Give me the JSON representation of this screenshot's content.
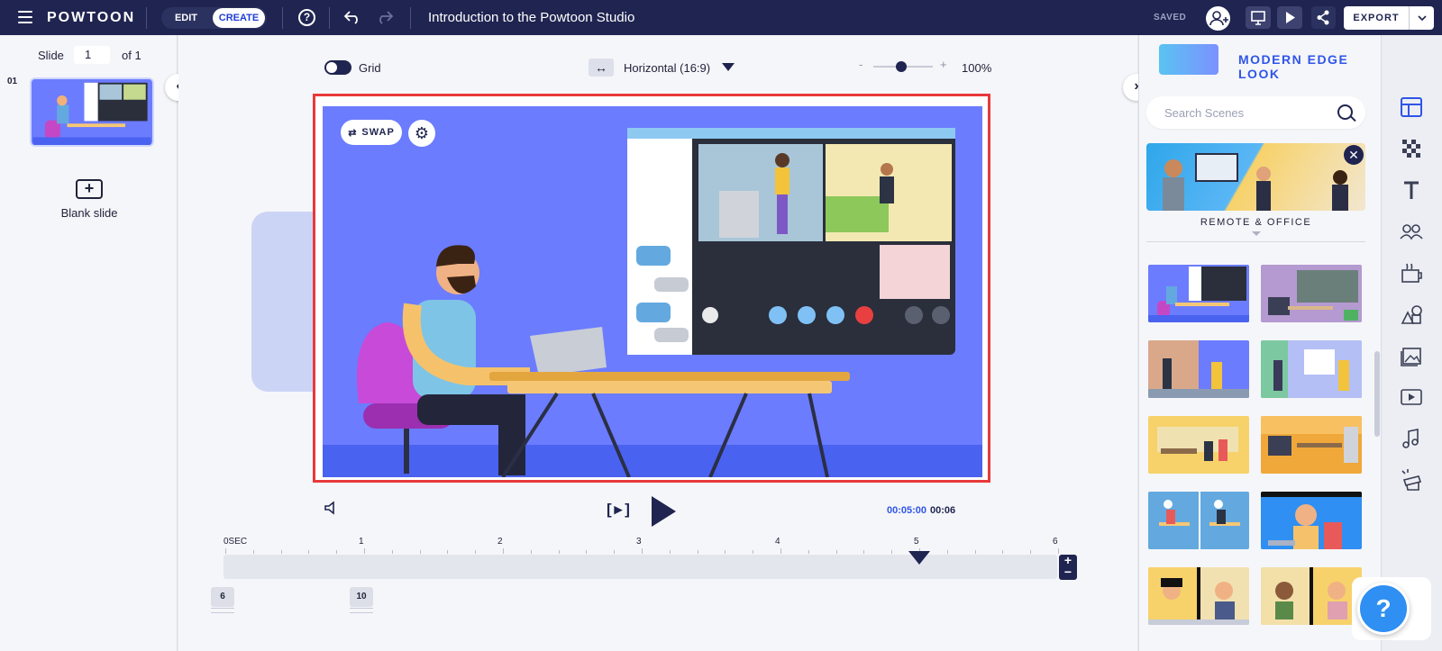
{
  "app": {
    "logo": "POWTOON",
    "title": "Introduction to the Powtoon Studio",
    "saved": "SAVED"
  },
  "mode": {
    "edit": "EDIT",
    "create": "CREATE"
  },
  "toolbar": {
    "export": "EXPORT"
  },
  "slides": {
    "label": "Slide",
    "current": "1",
    "of": "of 1",
    "index": "01",
    "blank_label": "Blank slide"
  },
  "canvas": {
    "grid_label": "Grid",
    "orientation": "Horizontal (16:9)",
    "zoom_value": "100%",
    "swap_label": "SWAP"
  },
  "player": {
    "time_current": "00:05:00",
    "time_separator": "|",
    "time_total": "00:06"
  },
  "timeline": {
    "ticks": [
      "0SEC",
      "1",
      "2",
      "3",
      "4",
      "5",
      "6"
    ],
    "markers": [
      "6",
      "10"
    ],
    "playhead_seconds": 5,
    "duration_seconds": 6
  },
  "right_panel": {
    "look_title": "MODERN EDGE LOOK",
    "search_placeholder": "Search Scenes",
    "featured_caption": "REMOTE & OFFICE"
  },
  "colors": {
    "topbar": "#1f2450",
    "accent": "#2f55e8",
    "stage": "#6b7cff",
    "selection": "#e8393a"
  }
}
